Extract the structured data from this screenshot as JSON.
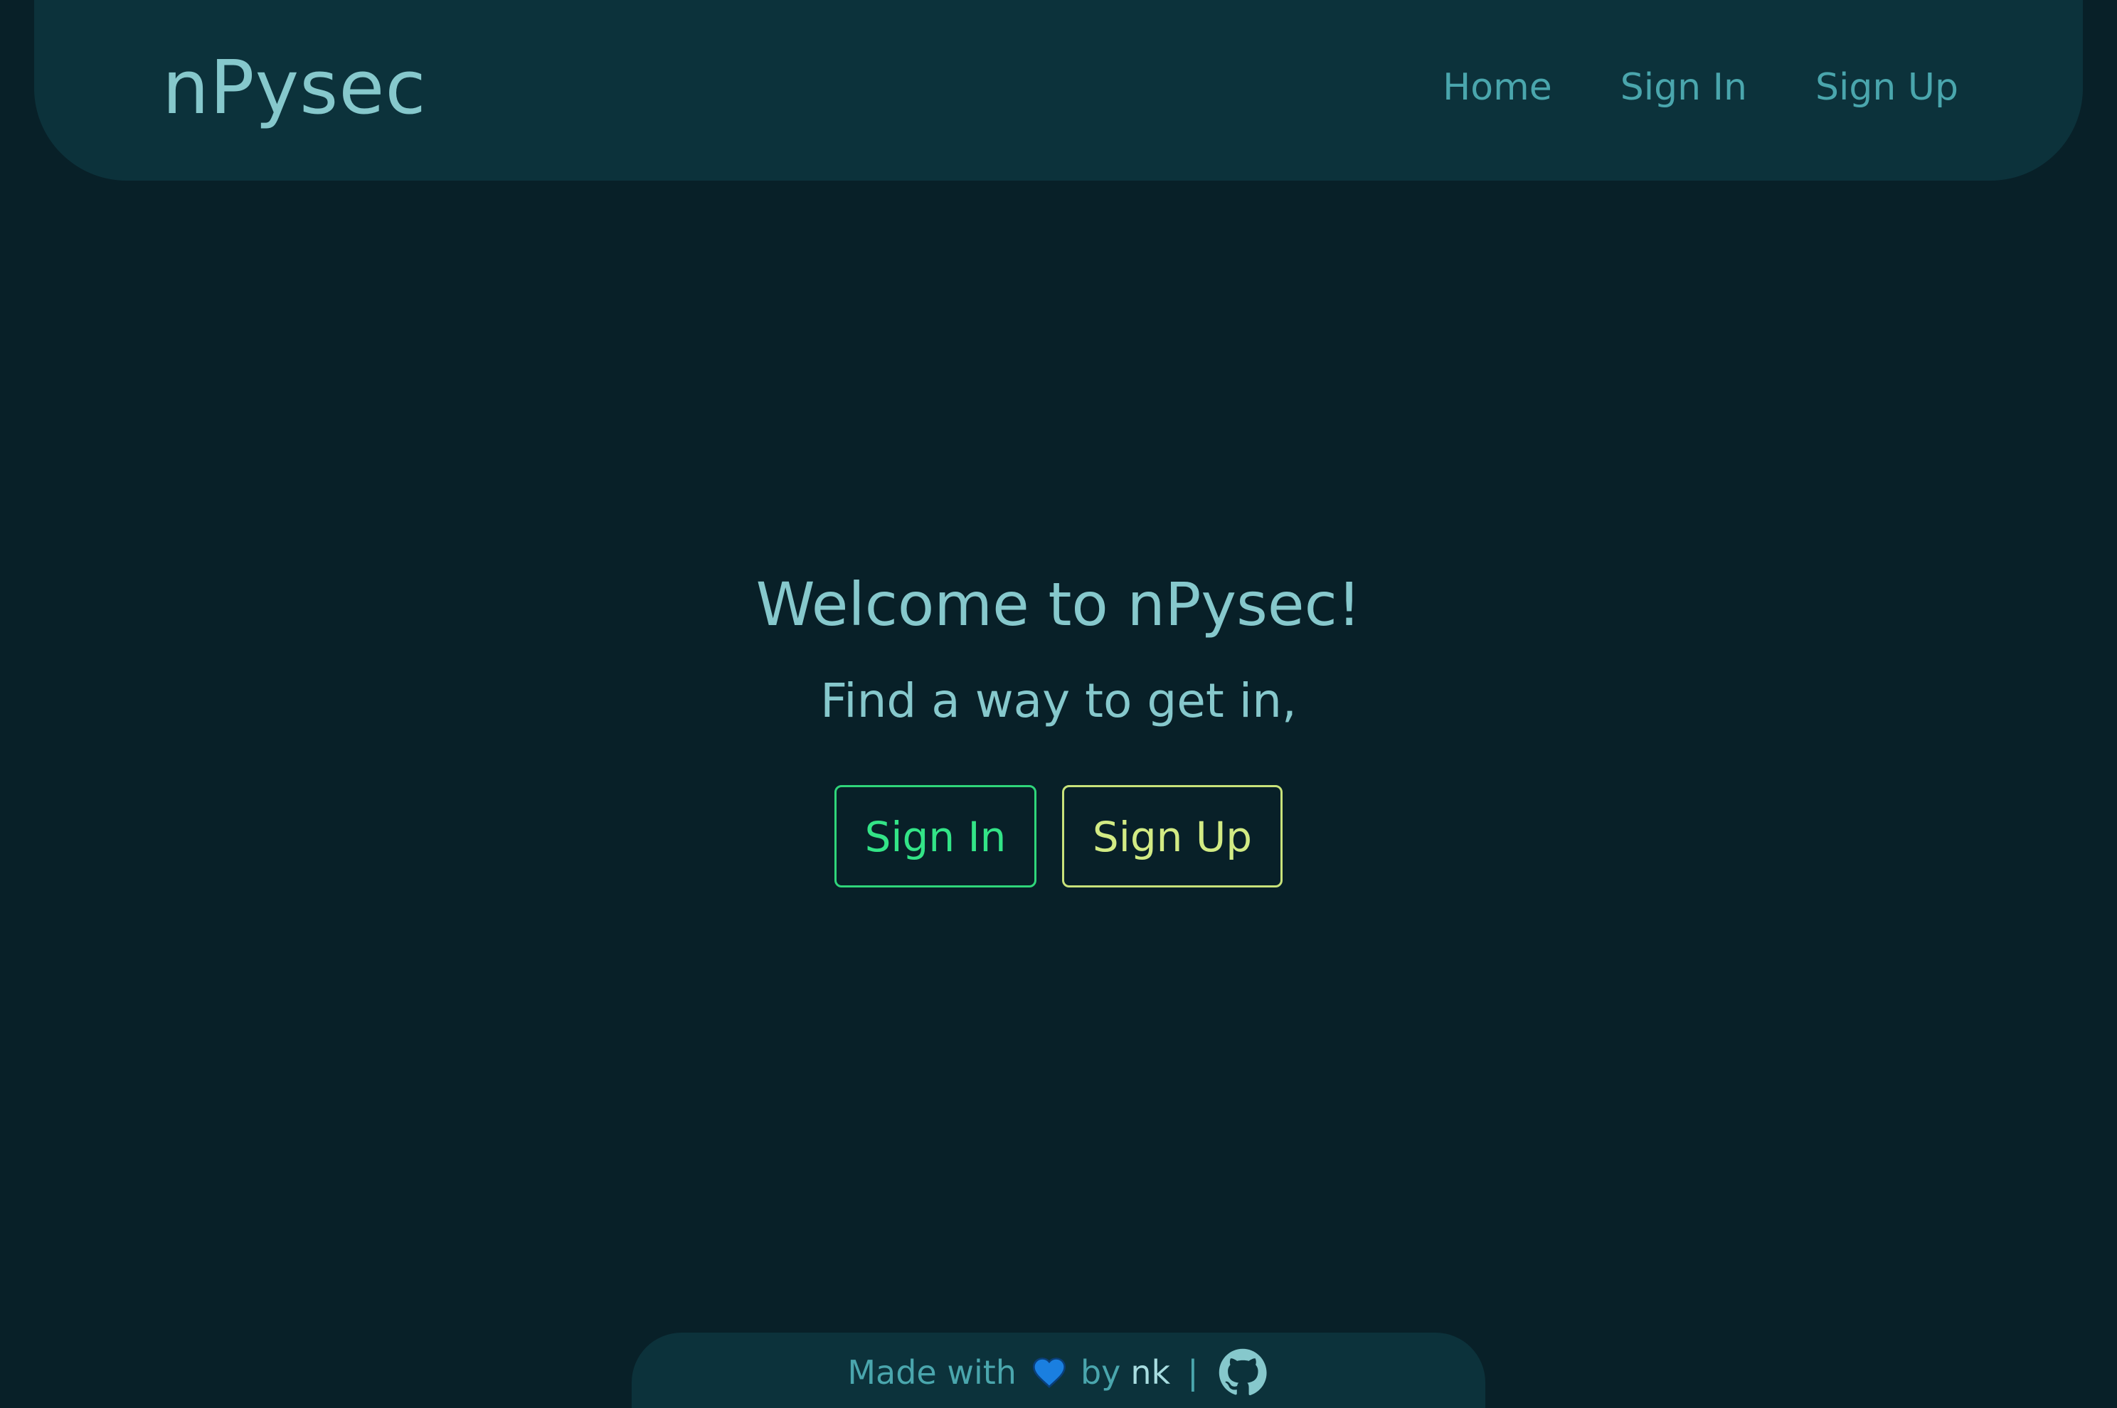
{
  "header": {
    "brand": "nPysec",
    "nav": [
      {
        "label": "Home"
      },
      {
        "label": "Sign In"
      },
      {
        "label": "Sign Up"
      }
    ]
  },
  "hero": {
    "title": "Welcome to nPysec!",
    "subtitle": "Find a way to get in,",
    "signin_label": "Sign In",
    "signup_label": "Sign Up"
  },
  "footer": {
    "made_with": "Made with",
    "by": "by",
    "author": "nk",
    "separator": "|",
    "heart_icon": "blue-heart-icon",
    "github_icon": "github-icon"
  },
  "colors": {
    "background": "#082028",
    "panel": "#0c323b",
    "text": "#86c8cc",
    "link": "#4aa6ad",
    "signin_accent": "#33e487",
    "signup_accent": "#d2eb84",
    "heart": "#1a7fe0"
  }
}
